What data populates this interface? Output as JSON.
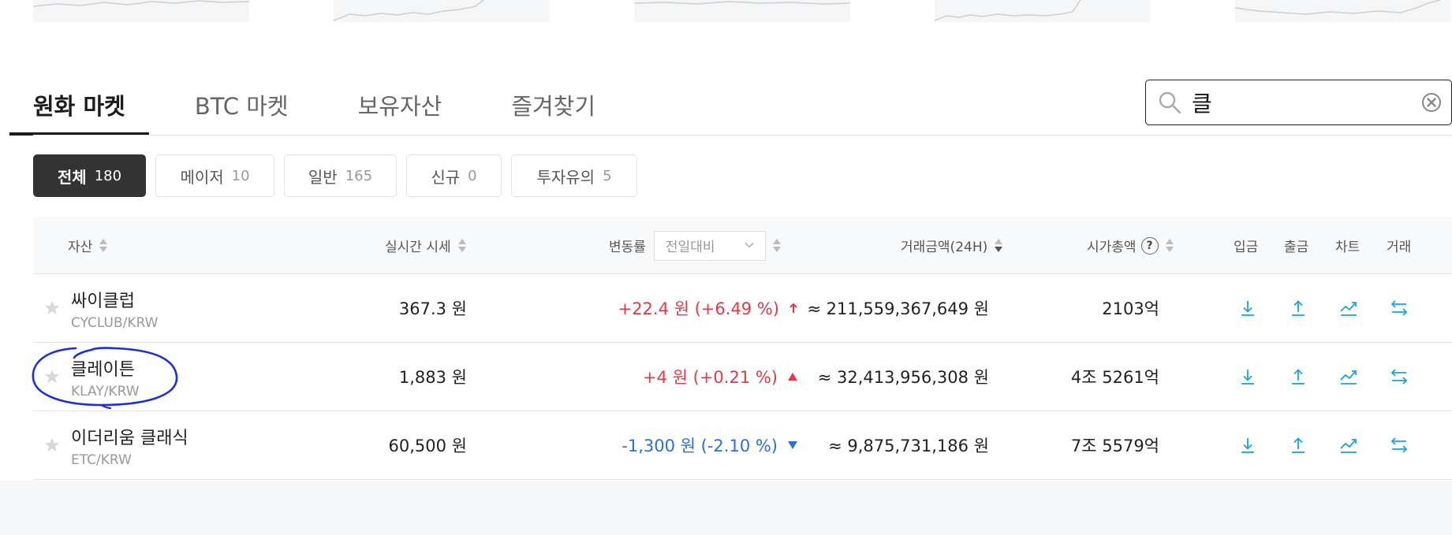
{
  "tabs": [
    {
      "label": "원화 마켓",
      "active": true
    },
    {
      "label": "BTC 마켓",
      "active": false
    },
    {
      "label": "보유자산",
      "active": false
    },
    {
      "label": "즐겨찾기",
      "active": false
    }
  ],
  "search": {
    "value": "클",
    "placeholder": ""
  },
  "filters": [
    {
      "label": "전체",
      "count": "180",
      "active": true
    },
    {
      "label": "메이저",
      "count": "10",
      "active": false
    },
    {
      "label": "일반",
      "count": "165",
      "active": false
    },
    {
      "label": "신규",
      "count": "0",
      "active": false
    },
    {
      "label": "투자유의",
      "count": "5",
      "active": false
    }
  ],
  "table": {
    "headers": {
      "asset": "자산",
      "price": "실시간 시세",
      "change": "변동률",
      "change_select": "전일대비",
      "volume": "거래금액(24H)",
      "mcap": "시가총액",
      "mcap_help": "?",
      "deposit": "입금",
      "withdraw": "출금",
      "chart": "차트",
      "trade": "거래"
    },
    "rows": [
      {
        "name": "싸이클럽",
        "symbol": "CYCLUB/KRW",
        "price": "367.3 원",
        "change": "+22.4 원 (+6.49 %)",
        "direction": "up",
        "volume": "≈ 211,559,367,649 원",
        "mcap": "2103억"
      },
      {
        "name": "클레이튼",
        "symbol": "KLAY/KRW",
        "price": "1,883 원",
        "change": "+4 원 (+0.21 %)",
        "direction": "up",
        "volume": "≈ 32,413,956,308 원",
        "mcap": "4조 5261억"
      },
      {
        "name": "이더리움 클래식",
        "symbol": "ETC/KRW",
        "price": "60,500 원",
        "change": "-1,300 원 (-2.10 %)",
        "direction": "down",
        "volume": "≈ 9,875,731,186 원",
        "mcap": "7조 5579억"
      }
    ]
  },
  "colors": {
    "up": "#e03b47",
    "down": "#2a6fdb",
    "icon": "#1aa3e0",
    "annotation": "#1c2fe0"
  },
  "icons": [
    "search-icon",
    "clear-icon",
    "star-icon",
    "deposit-icon",
    "withdraw-icon",
    "chart-icon",
    "trade-icon",
    "sort-icon"
  ]
}
